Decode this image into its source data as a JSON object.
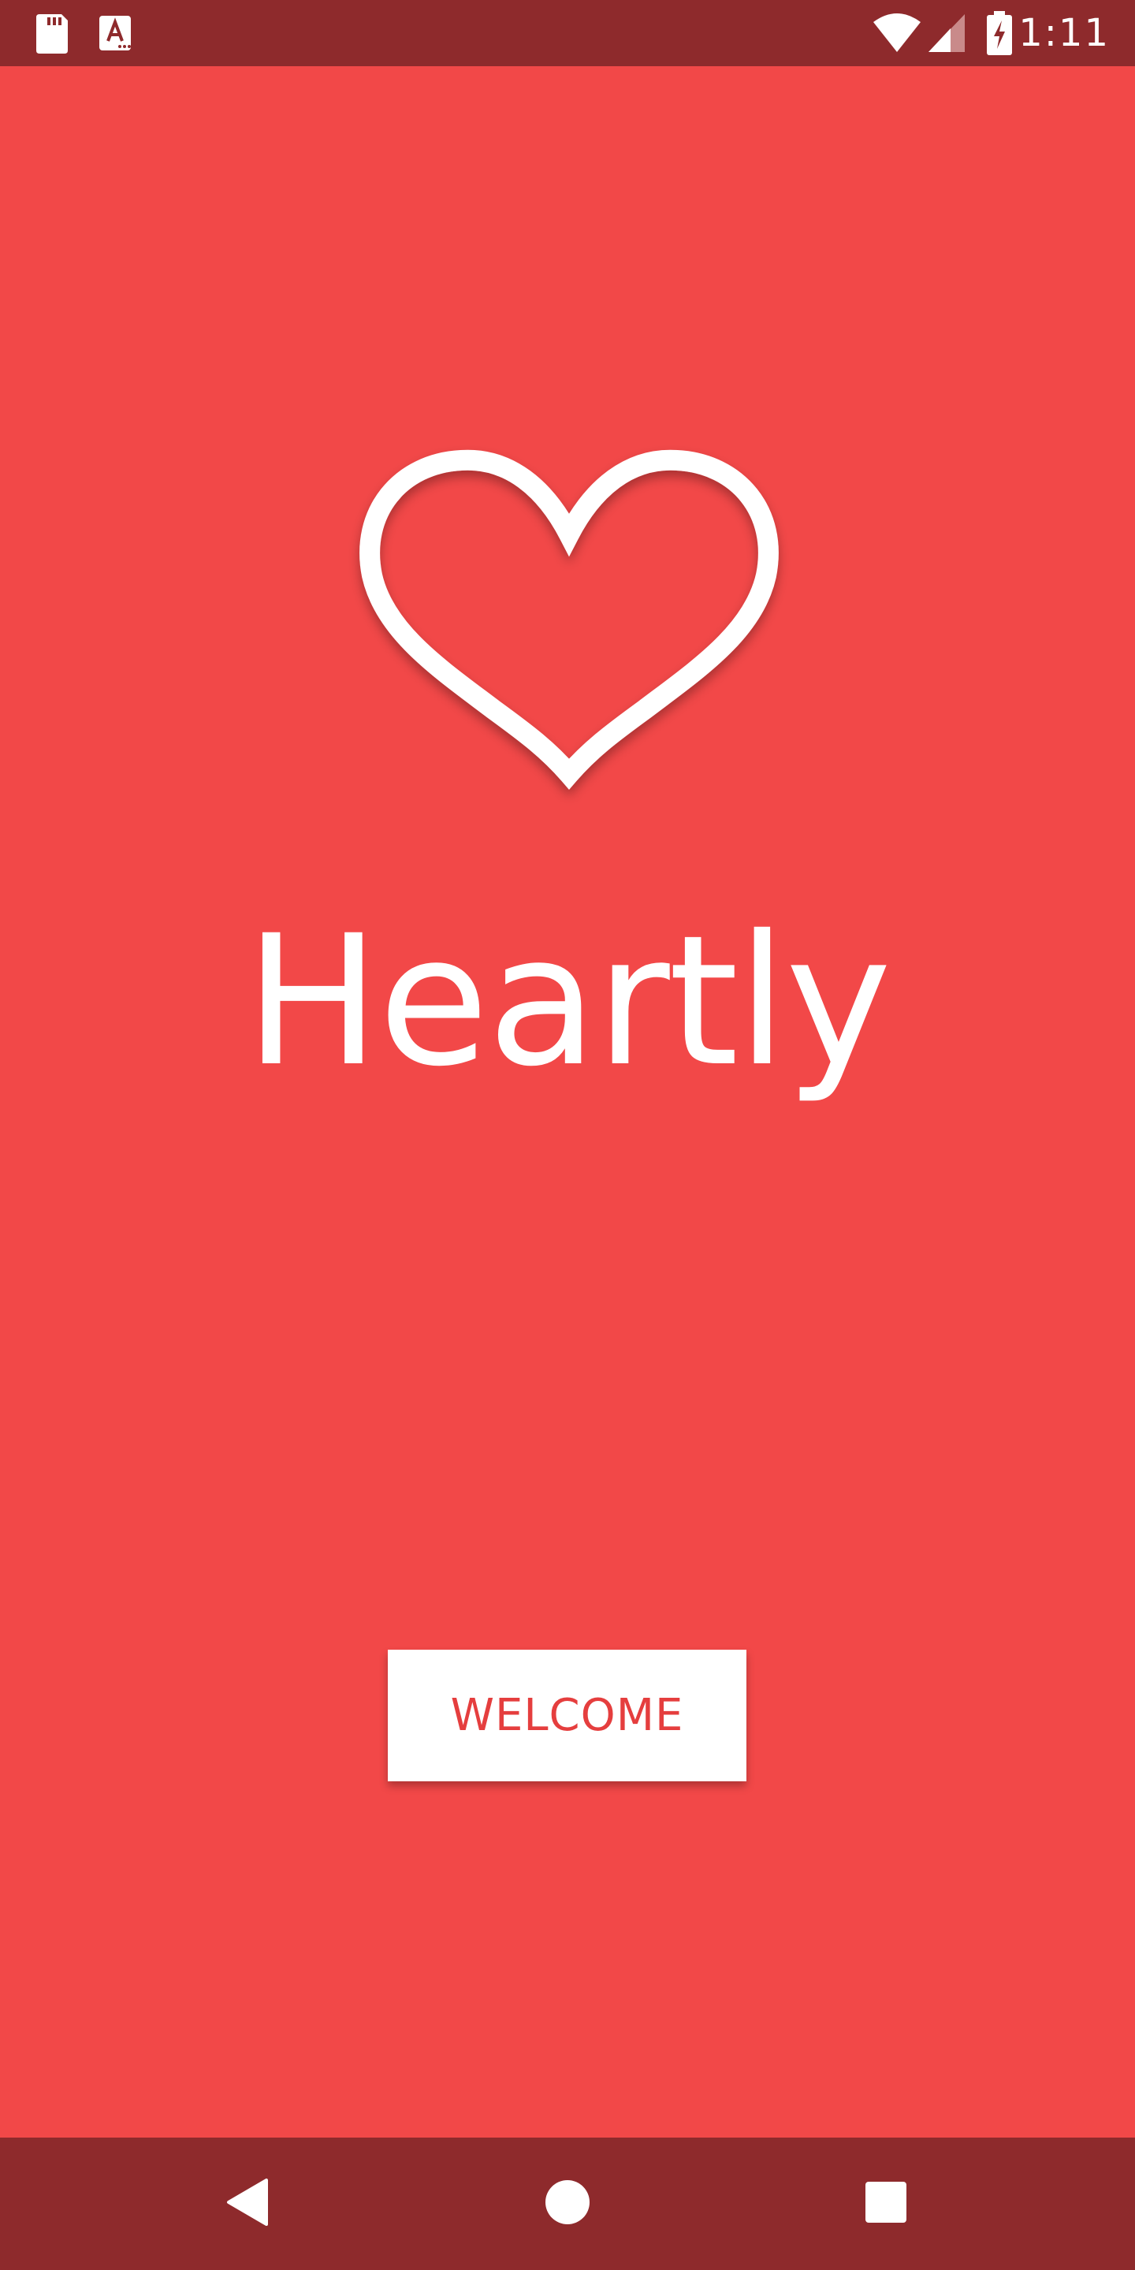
{
  "status_bar": {
    "time": "1:11",
    "left_icons": [
      "sd-card-icon",
      "keyboard-a-icon"
    ],
    "right_icons": [
      "wifi-icon",
      "cell-signal-icon",
      "battery-charging-icon"
    ],
    "background": "#8e2a2c"
  },
  "app": {
    "title": "Heartly",
    "logo_icon": "heart-outline-icon",
    "background": "#f24848",
    "welcome_label": "WELCOME",
    "welcome_label_color": "#e53e3e"
  },
  "nav_bar": {
    "buttons": [
      "back-icon",
      "home-icon",
      "recents-icon"
    ],
    "background": "#8e2a2c"
  }
}
